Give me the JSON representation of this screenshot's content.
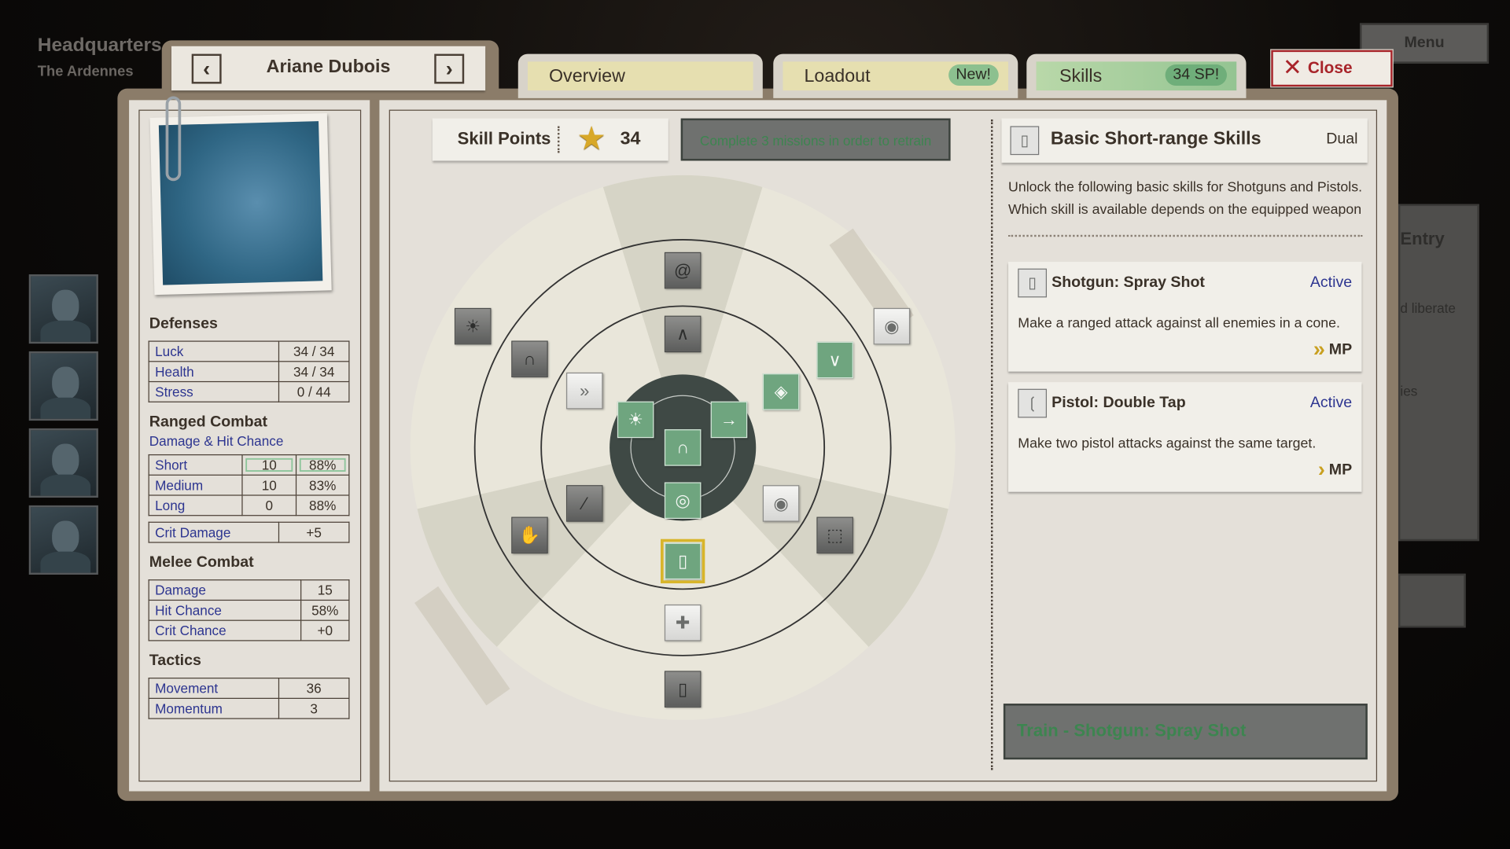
{
  "location": {
    "title": "Headquarters",
    "subtitle": "The Ardennes"
  },
  "character": {
    "name": "Ariane Dubois",
    "prev_icon": "chevron-left-icon",
    "next_icon": "chevron-right-icon"
  },
  "tabs": [
    {
      "label": "Overview",
      "badge": ""
    },
    {
      "label": "Loadout",
      "badge": "New!"
    },
    {
      "label": "Skills",
      "badge": "34 SP!",
      "active": true
    }
  ],
  "close_label": "Close",
  "menu_label": "Menu",
  "background_panel": {
    "heading": "Entry",
    "line1": "d liberate",
    "line2": "ies"
  },
  "stats": {
    "defenses": {
      "title": "Defenses",
      "rows": [
        {
          "label": "Luck",
          "value": "34 / 34"
        },
        {
          "label": "Health",
          "value": "34 / 34"
        },
        {
          "label": "Stress",
          "value": "0 / 44"
        }
      ]
    },
    "ranged": {
      "title": "Ranged Combat",
      "subtitle": "Damage & Hit Chance",
      "rows": [
        {
          "label": "Short",
          "damage": "10",
          "hit": "88%"
        },
        {
          "label": "Medium",
          "damage": "10",
          "hit": "83%"
        },
        {
          "label": "Long",
          "damage": "0",
          "hit": "88%"
        }
      ],
      "crit": {
        "label": "Crit Damage",
        "value": "+5"
      }
    },
    "melee": {
      "title": "Melee Combat",
      "rows": [
        {
          "label": "Damage",
          "value": "15"
        },
        {
          "label": "Hit Chance",
          "value": "58%"
        },
        {
          "label": "Crit Chance",
          "value": "+0"
        }
      ]
    },
    "tactics": {
      "title": "Tactics",
      "rows": [
        {
          "label": "Movement",
          "value": "36"
        },
        {
          "label": "Momentum",
          "value": "3"
        }
      ]
    }
  },
  "skill_points": {
    "label": "Skill Points",
    "value": "34"
  },
  "retrain_label": "Complete 3 missions in order to retrain",
  "skill_tree": {
    "nodes": [
      {
        "icon": "spiral-icon",
        "state": "locked"
      },
      {
        "icon": "bat-icon",
        "state": "locked"
      },
      {
        "icon": "aura-figure-icon",
        "state": "locked"
      },
      {
        "icon": "fangs-drop-icon",
        "state": "locked"
      },
      {
        "icon": "sprint-icon",
        "state": "available"
      },
      {
        "icon": "radiant-figure-icon",
        "state": "learned"
      },
      {
        "icon": "runner-icon",
        "state": "learned"
      },
      {
        "icon": "fangs-icon",
        "state": "learned"
      },
      {
        "icon": "target-icon",
        "state": "learned"
      },
      {
        "icon": "shield-icon",
        "state": "learned"
      },
      {
        "icon": "shield-chevrons-icon",
        "state": "learned"
      },
      {
        "icon": "eye-figure-icon",
        "state": "available"
      },
      {
        "icon": "feather-icon",
        "state": "locked"
      },
      {
        "icon": "fangs-hand-icon",
        "state": "locked"
      },
      {
        "icon": "eye-icon",
        "state": "available"
      },
      {
        "icon": "dash-path-icon",
        "state": "locked"
      },
      {
        "icon": "shotgun-shell-icon",
        "state": "selected"
      },
      {
        "icon": "bullet-plus-icon",
        "state": "available"
      },
      {
        "icon": "magazine-icon",
        "state": "locked"
      }
    ]
  },
  "detail": {
    "title": "Basic Short-range Skills",
    "tag": "Dual",
    "description": "Unlock the following basic skills for Shotguns and Pistols. Which skill is available depends on the equipped weapon",
    "skills": [
      {
        "name": "Shotgun: Spray Shot",
        "status": "Active",
        "description": "Make a ranged attack against all enemies in a cone.",
        "cost": "MP",
        "cost_icon": "double-chevron-icon"
      },
      {
        "name": "Pistol: Double Tap",
        "status": "Active",
        "description": "Make two pistol attacks against the same target.",
        "cost": "MP",
        "cost_icon": "chevron-icon"
      }
    ],
    "train_label": "Train - Shotgun: Spray Shot"
  },
  "colors": {
    "accent_green": "#6fa57f",
    "close_red": "#a8242a",
    "link_blue": "#2d3590",
    "selected_gold": "#d8b52a"
  }
}
